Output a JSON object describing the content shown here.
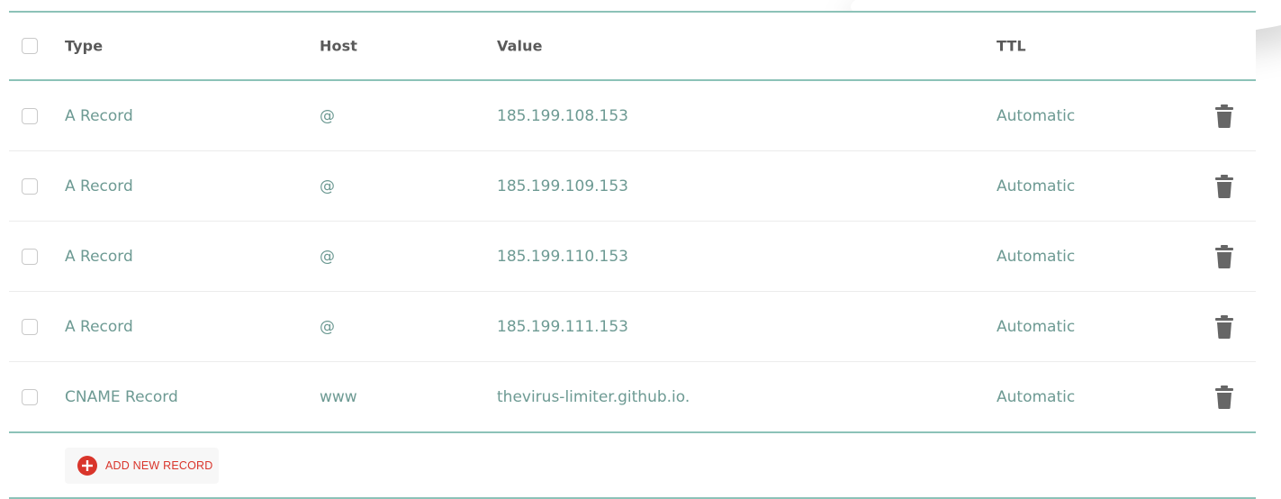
{
  "table": {
    "columns": {
      "type": "Type",
      "host": "Host",
      "value": "Value",
      "ttl": "TTL"
    },
    "rows": [
      {
        "type": "A Record",
        "host": "@",
        "value": "185.199.108.153",
        "ttl": "Automatic"
      },
      {
        "type": "A Record",
        "host": "@",
        "value": "185.199.109.153",
        "ttl": "Automatic"
      },
      {
        "type": "A Record",
        "host": "@",
        "value": "185.199.110.153",
        "ttl": "Automatic"
      },
      {
        "type": "A Record",
        "host": "@",
        "value": "185.199.111.153",
        "ttl": "Automatic"
      },
      {
        "type": "CNAME Record",
        "host": "www",
        "value": "thevirus-limiter.github.io.",
        "ttl": "Automatic"
      }
    ],
    "row_icons": {
      "select": "checkbox-icon",
      "delete": "trash-icon"
    }
  },
  "footer": {
    "add_record_label": "ADD NEW RECORD",
    "add_record_icon": "plus-circle-icon"
  },
  "colors": {
    "accent_line": "#8cc2b8",
    "cell_text": "#6d9a93",
    "header_text": "#5a5a5a",
    "delete_icon": "#666666",
    "add_button_red": "#d9352b",
    "add_button_bg": "#f7f7f7"
  }
}
